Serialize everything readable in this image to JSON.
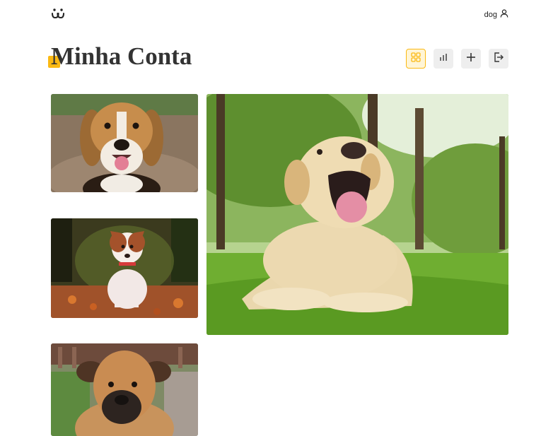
{
  "header": {
    "username": "dog",
    "logo_icon": "dog-face-logo-icon",
    "user_icon": "user-icon"
  },
  "page": {
    "title": "Minha Conta"
  },
  "toolbar": [
    {
      "name": "grid-view",
      "icon": "grid-icon",
      "active": true
    },
    {
      "name": "stats",
      "icon": "bar-chart-icon",
      "active": false
    },
    {
      "name": "add-photo",
      "icon": "plus-icon",
      "active": false
    },
    {
      "name": "logout",
      "icon": "logout-icon",
      "active": false
    }
  ],
  "feed": [
    {
      "subject": "beagle"
    },
    {
      "subject": "jack-russell-puppy"
    },
    {
      "subject": "boxer"
    },
    {
      "subject": "labrador"
    }
  ],
  "colors": {
    "accent": "#fbb913",
    "text": "#333333",
    "button_bg": "#eeeeee"
  }
}
